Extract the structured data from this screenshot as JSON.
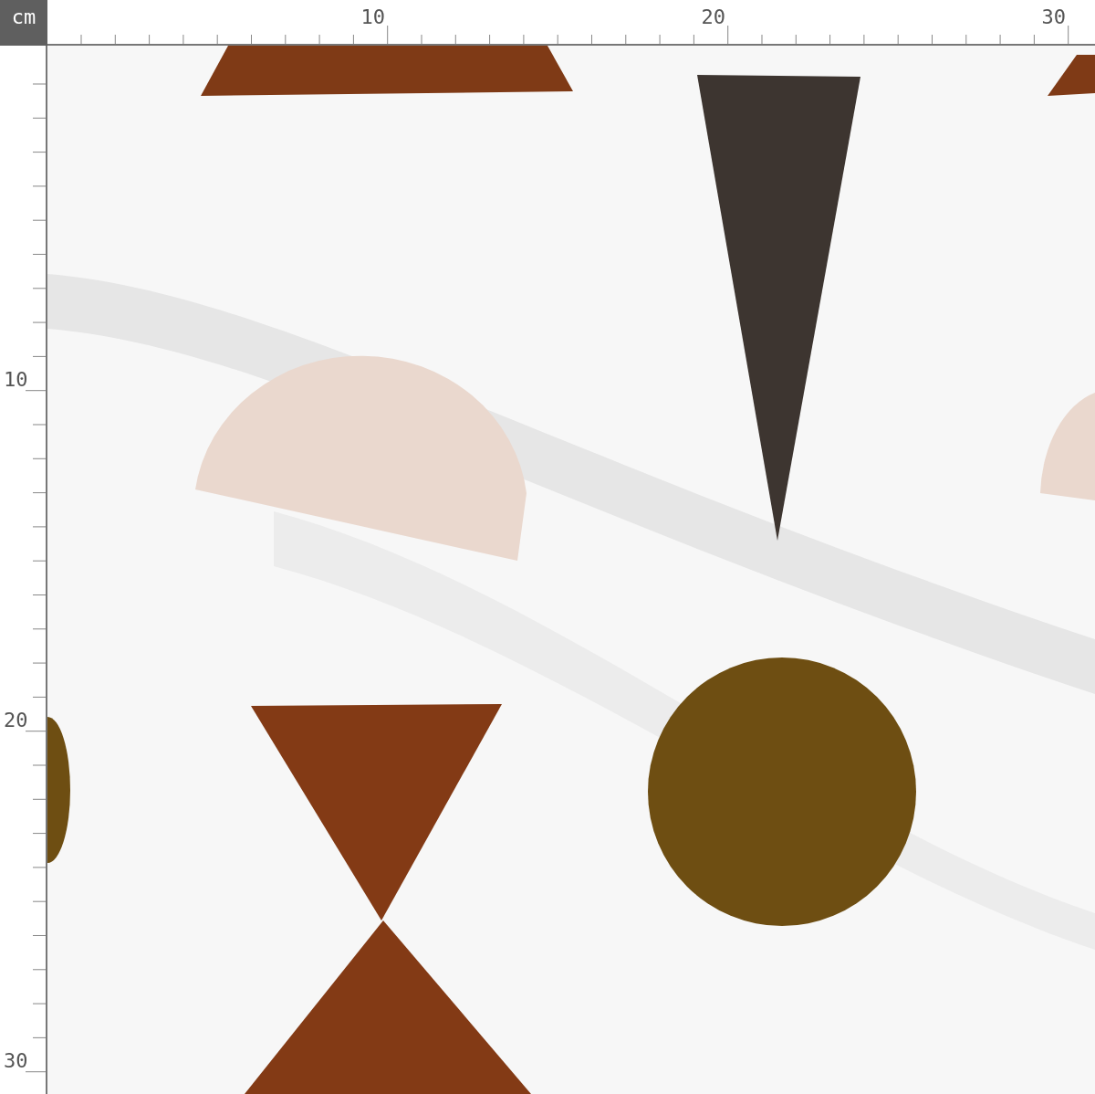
{
  "corner_unit": "cm",
  "top_ruler": {
    "labels": [
      "10",
      "20",
      "30"
    ]
  },
  "left_ruler": {
    "labels": [
      "10",
      "20",
      "30"
    ]
  }
}
